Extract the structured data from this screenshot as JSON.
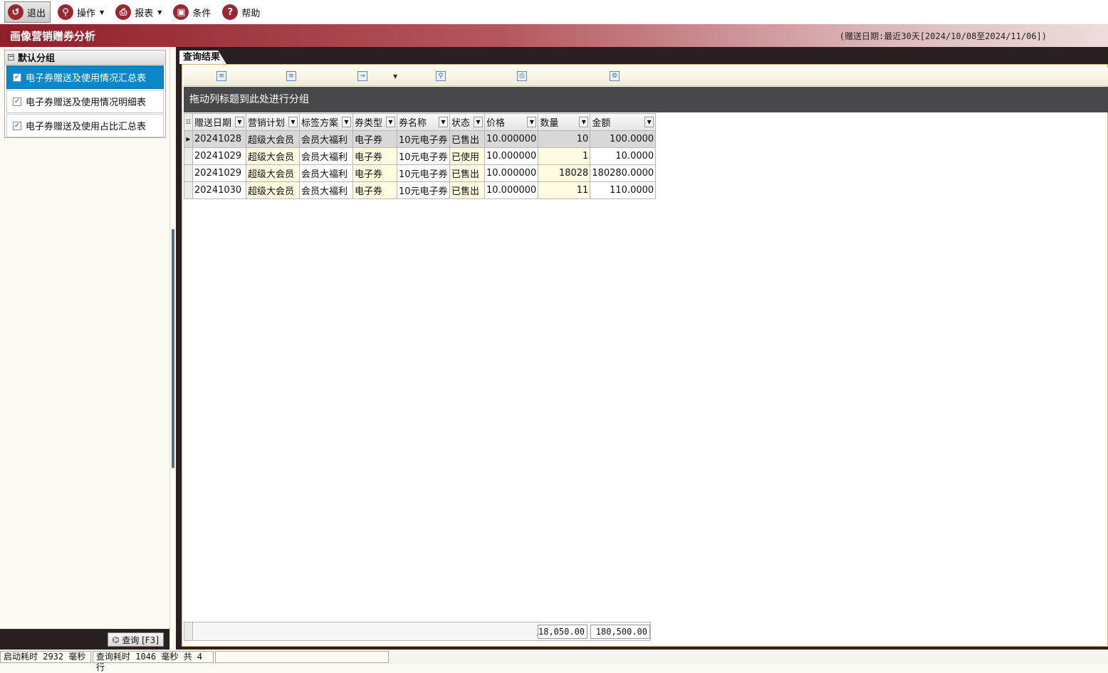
{
  "toolbar": {
    "exit": "退出",
    "operate": "操作",
    "report": "报表",
    "condition": "条件",
    "help": "帮助"
  },
  "titlebar": {
    "title": "画像营销赠券分析",
    "range": "(赠送日期:最近30天[2024/10/08至2024/11/06])"
  },
  "group": {
    "header": "默认分组",
    "items": [
      {
        "label": "电子券赠送及使用情况汇总表"
      },
      {
        "label": "电子券赠送及使用情况明细表"
      },
      {
        "label": "电子券赠送及使用占比汇总表"
      }
    ]
  },
  "query_button": "查询 [F3]",
  "tab": "查询结果",
  "group_zone": "拖动列标题到此处进行分组",
  "columns": [
    "赠送日期",
    "营销计划",
    "标签方案",
    "券类型",
    "券名称",
    "状态",
    "价格",
    "数量",
    "金额"
  ],
  "rows": [
    {
      "date": "20241028",
      "plan": "超级大会员",
      "tag": "会员大福利",
      "type": "电子券",
      "name": "10元电子券",
      "status": "已售出",
      "price": "10.000000",
      "qty": "10",
      "amount": "100.0000"
    },
    {
      "date": "20241029",
      "plan": "超级大会员",
      "tag": "会员大福利",
      "type": "电子券",
      "name": "10元电子券",
      "status": "已使用",
      "price": "10.000000",
      "qty": "1",
      "amount": "10.0000"
    },
    {
      "date": "20241029",
      "plan": "超级大会员",
      "tag": "会员大福利",
      "type": "电子券",
      "name": "10元电子券",
      "status": "已售出",
      "price": "10.000000",
      "qty": "18028",
      "amount": "180280.0000"
    },
    {
      "date": "20241030",
      "plan": "超级大会员",
      "tag": "会员大福利",
      "type": "电子券",
      "name": "10元电子券",
      "status": "已售出",
      "price": "10.000000",
      "qty": "11",
      "amount": "110.0000"
    }
  ],
  "totals": {
    "qty": "18,050.00",
    "amount": "180,500.00"
  },
  "status": {
    "startup": "启动耗时 2932 毫秒",
    "query": "查询耗时 1046 毫秒  共 4 行",
    "extra": ""
  }
}
